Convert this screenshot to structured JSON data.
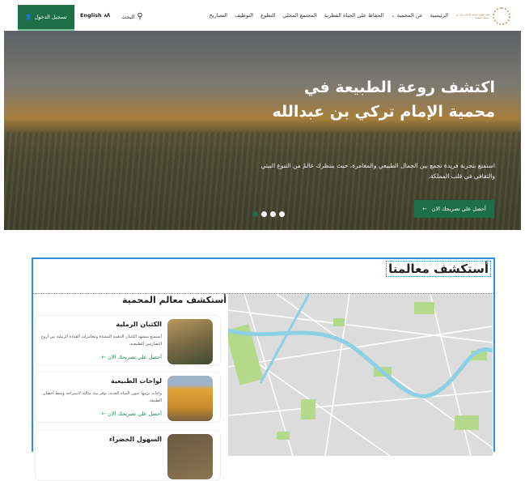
{
  "header": {
    "logo_text": "هيئة تطوير محمية الإمام تركي بن عبدالله الملكية",
    "nav": [
      "الرئيسية",
      "عن المحمية",
      "الحفاظ على الحياة الفطرية",
      "المجتمع المحلي",
      "التطوع",
      "التوظيف",
      "التصاريح"
    ],
    "search": "البحث",
    "language": "English",
    "login": "تسجيل الدخول"
  },
  "hero": {
    "title": "اكتشف روعة الطبيعة في محمية الإمام تركي بن عبدالله",
    "text": "استمتع بتجربة فريدة تجمع بين الجمال الطبيعي والمغامرة، حيث ينتظرك عالمٌ من التنوع البيئي والثقافي في قلب المملكة.",
    "button": "أحصل علي تصريحك الان",
    "slides": 4,
    "active_slide": 1
  },
  "section": {
    "title": "أستكشف معالمنا",
    "subtitle": "أستكشف معالم المحمية",
    "cards": [
      {
        "title": "الكثبان الرملية",
        "text": "أستمتع بمشهد الكثبان الذهبية الممتدة ومغامرات القيادة الرملية بين أروع التضاريس الطبيعية.",
        "link": "أحصل علي تصريحك الان"
      },
      {
        "title": "لواحات الطبيعية",
        "text": "واحات تزينها عيون المياه العذبة، توفر بيئة مثالية لاستراحة وسط أحضان الطبيعة.",
        "link": "أحصل علي تصريحك الان"
      },
      {
        "title": "السهول الخضراء"
      }
    ]
  },
  "colors": {
    "brand": "#1e6e47",
    "accent": "#2f8fe0"
  }
}
